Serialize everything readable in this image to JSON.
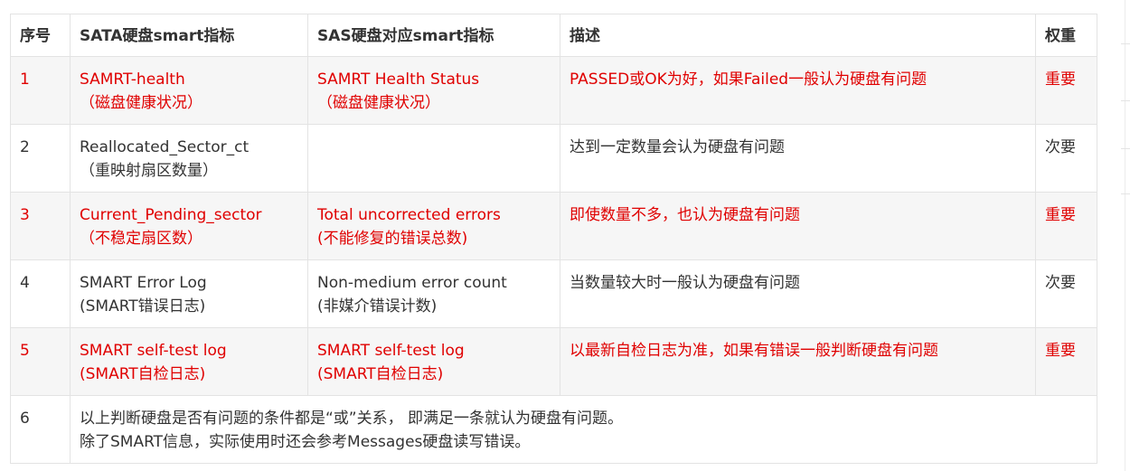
{
  "table": {
    "headers": [
      "序号",
      "SATA硬盘smart指标",
      "SAS硬盘对应smart指标",
      "描述",
      "权重"
    ],
    "rows": [
      {
        "no": "1",
        "sata": [
          "SAMRT-health",
          "（磁盘健康状况）"
        ],
        "sas": [
          "SAMRT Health Status",
          "（磁盘健康状况）"
        ],
        "desc": "PASSED或OK为好，如果Failed一般认为硬盘有问题",
        "weight": "重要"
      },
      {
        "no": "2",
        "sata": [
          "Reallocated_Sector_ct",
          "（重映射扇区数量）"
        ],
        "sas": [
          "",
          ""
        ],
        "desc": "达到一定数量会认为硬盘有问题",
        "weight": "次要"
      },
      {
        "no": "3",
        "sata": [
          "Current_Pending_sector",
          "（不稳定扇区数）"
        ],
        "sas": [
          "Total uncorrected errors",
          "(不能修复的错误总数)"
        ],
        "desc": "即使数量不多，也认为硬盘有问题",
        "weight": "重要"
      },
      {
        "no": "4",
        "sata": [
          "SMART Error Log",
          "(SMART错误日志)"
        ],
        "sas": [
          "Non-medium error count",
          "(非媒介错误计数)"
        ],
        "desc": "当数量较大时一般认为硬盘有问题",
        "weight": "次要"
      },
      {
        "no": "5",
        "sata": [
          "SMART self-test log",
          "(SMART自检日志)"
        ],
        "sas": [
          "SMART self-test log",
          "(SMART自检日志)"
        ],
        "desc": "以最新自检日志为准，如果有错误一般判断硬盘有问题",
        "weight": "重要"
      }
    ],
    "note": {
      "no": "6",
      "lines": [
        "以上判断硬盘是否有问题的条件都是“或”关系， 即满足一条就认为硬盘有问题。",
        "除了SMART信息，实际使用时还会参考Messages硬盘读写错误。"
      ]
    }
  },
  "colors": {
    "important_text": "#e00000",
    "normal_text": "#333333",
    "alt_row_bg": "#f6f6f6",
    "border": "#e3e3e3"
  }
}
